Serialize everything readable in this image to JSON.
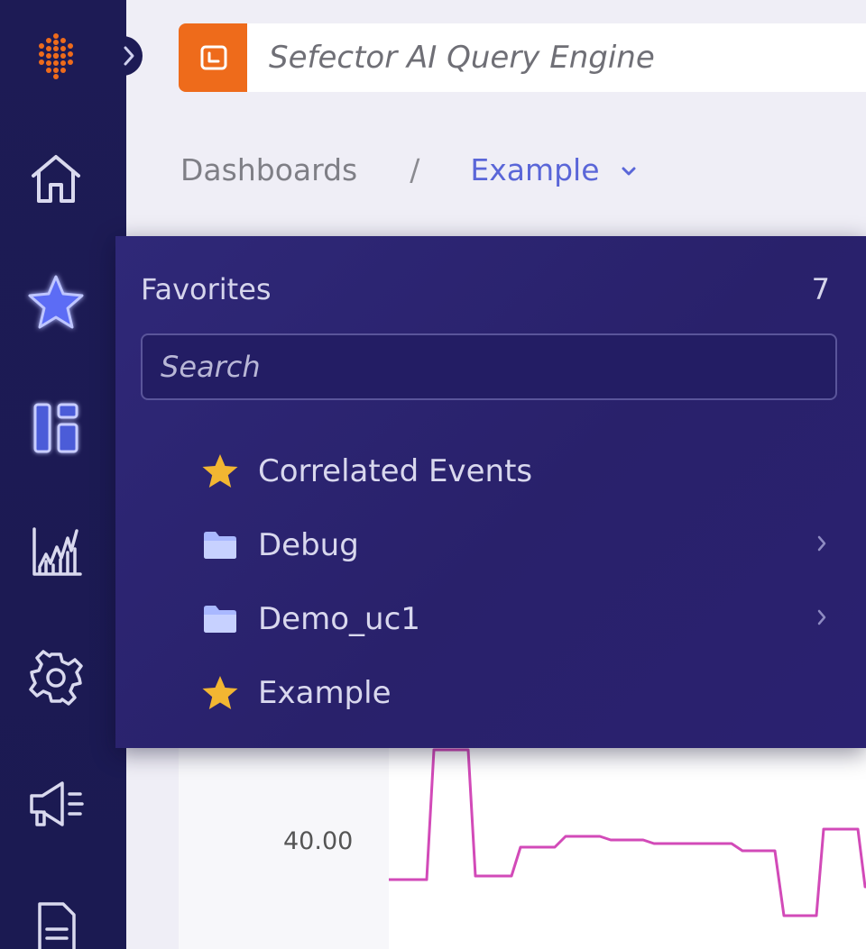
{
  "topbar": {
    "engine_placeholder": "Sefector AI Query Engine"
  },
  "breadcrumb": {
    "root": "Dashboards",
    "separator": "/",
    "current": "Example"
  },
  "favorites": {
    "title": "Favorites",
    "count": "7",
    "search_placeholder": "Search",
    "items": [
      {
        "label": "Correlated Events",
        "icon": "star-icon",
        "has_children": false
      },
      {
        "label": "Debug",
        "icon": "folder-icon",
        "has_children": true
      },
      {
        "label": "Demo_uc1",
        "icon": "folder-icon",
        "has_children": true
      },
      {
        "label": "Example",
        "icon": "star-icon",
        "has_children": false
      }
    ]
  },
  "nav": {
    "items": [
      "logo-icon",
      "home-icon",
      "star-icon",
      "dashboards-icon",
      "metrics-icon",
      "settings-icon",
      "announcements-icon",
      "document-icon"
    ],
    "active": "star-icon"
  },
  "chart_data": {
    "type": "line",
    "ytick_label": "40.00",
    "series": [
      {
        "values": [
          40.6,
          40.6,
          44.2,
          44.2,
          40.7,
          40.7,
          41.5,
          41.5,
          41.8,
          41.8,
          41.7,
          41.7,
          41.6,
          41.6,
          41.4,
          41.4,
          39.6,
          39.6,
          42.0,
          42.0,
          40.4,
          40.4
        ]
      }
    ],
    "colors": {
      "line": "#d24ab8"
    }
  },
  "colors": {
    "nav_bg": "#1d1b55",
    "accent_orange": "#ee6b1b",
    "breadcrumb_active": "#5a66d8",
    "popover_bg": "#2b2372",
    "star_gold": "#f2b632",
    "folder_blue": "#a9b8ff"
  }
}
